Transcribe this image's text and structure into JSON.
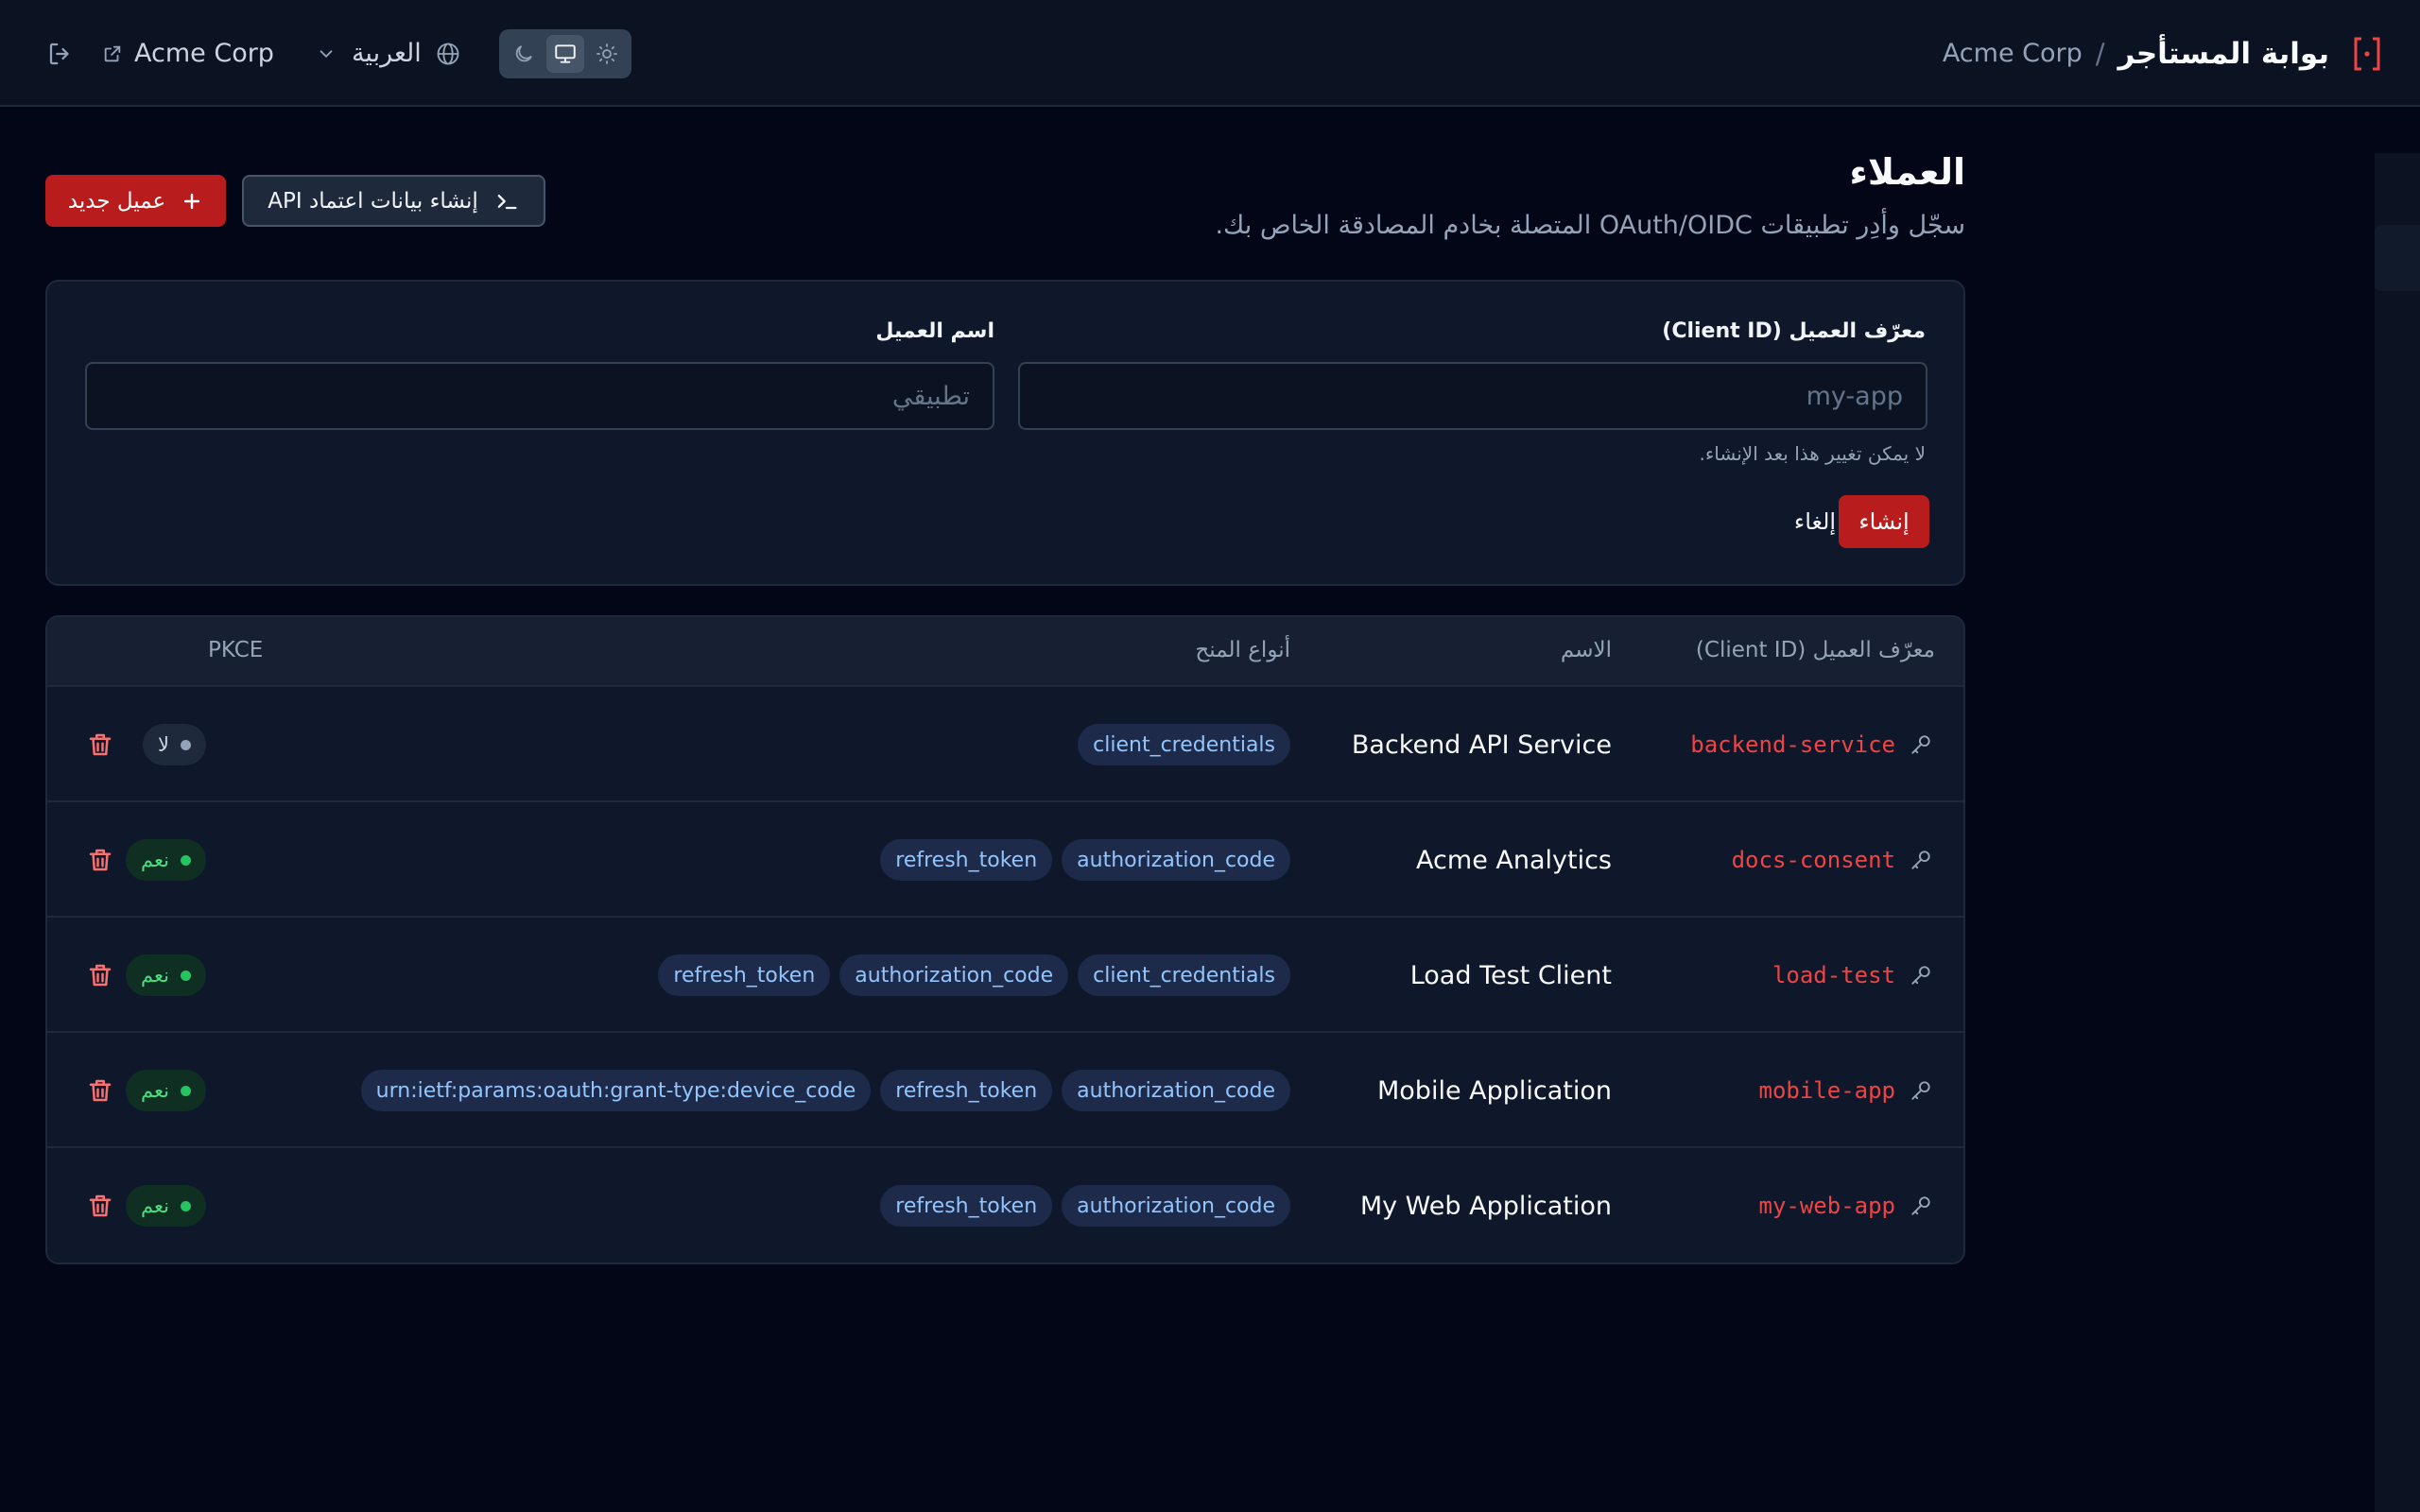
{
  "header": {
    "title": "بوابة المستأجر",
    "separator": "/",
    "tenant": "Acme Corp",
    "org_link": "Acme Corp",
    "language": "العربية"
  },
  "page": {
    "title": "العملاء",
    "subtitle": "سجّل وأدِر تطبيقات OAuth/OIDC المتصلة بخادم المصادقة الخاص بك."
  },
  "actions": {
    "new_client": "عميل جديد",
    "create_api_credentials": "إنشاء بيانات اعتماد API"
  },
  "form": {
    "client_id_label": "معرّف العميل (Client ID)",
    "client_id_placeholder": "my-app",
    "client_id_hint": "لا يمكن تغيير هذا بعد الإنشاء.",
    "client_name_label": "اسم العميل",
    "client_name_placeholder": "تطبيقي",
    "create": "إنشاء",
    "cancel": "إلغاء"
  },
  "table": {
    "headers": {
      "client_id": "معرّف العميل (Client ID)",
      "name": "الاسم",
      "grant_types": "أنواع المنح",
      "pkce": "PKCE"
    },
    "rows": [
      {
        "client_id": "backend-service",
        "name": "Backend API Service",
        "grants": [
          "client_credentials"
        ],
        "pkce": "لا",
        "pkce_enabled": false
      },
      {
        "client_id": "docs-consent",
        "name": "Acme Analytics",
        "grants": [
          "authorization_code",
          "refresh_token"
        ],
        "pkce": "نعم",
        "pkce_enabled": true
      },
      {
        "client_id": "load-test",
        "name": "Load Test Client",
        "grants": [
          "client_credentials",
          "authorization_code",
          "refresh_token"
        ],
        "pkce": "نعم",
        "pkce_enabled": true
      },
      {
        "client_id": "mobile-app",
        "name": "Mobile Application",
        "grants": [
          "authorization_code",
          "refresh_token",
          "urn:ietf:params:oauth:grant-type:device_code"
        ],
        "pkce": "نعم",
        "pkce_enabled": true
      },
      {
        "client_id": "my-web-app",
        "name": "My Web Application",
        "grants": [
          "authorization_code",
          "refresh_token"
        ],
        "pkce": "نعم",
        "pkce_enabled": true
      }
    ]
  },
  "icons": {
    "brand": "bracket-dot-icon",
    "logout": "logout-icon",
    "external": "external-link-icon",
    "chevron": "chevron-down-icon",
    "globe": "globe-icon",
    "theme": [
      "moon-icon",
      "monitor-icon",
      "sun-icon"
    ],
    "key": "key-icon",
    "delete": "trash-icon",
    "plus": "plus-icon",
    "terminal": "terminal-icon"
  },
  "colors": {
    "accent": "#b91c1c",
    "client_id_text": "#ef4444",
    "chip_text": "#93c5fd",
    "pkce_yes": "#22c55e",
    "background": "#020617"
  }
}
